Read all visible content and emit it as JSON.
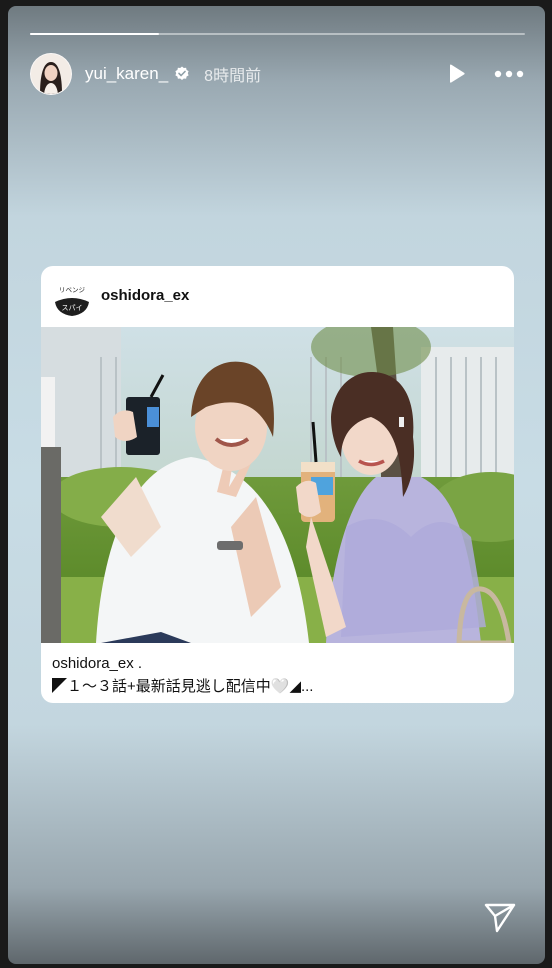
{
  "story": {
    "progress": 0.26,
    "username": "yui_karen_",
    "time_ago": "8時間前"
  },
  "shared_post": {
    "account": "oshidora_ex",
    "caption_user": "oshidora_ex .",
    "caption_text": "◤１～３話+最新話見逃し配信中🤍◢...",
    "logo_text": "リベンジスパイ"
  },
  "colors": {
    "accent": "#ffffff",
    "background": "#c8dce5"
  },
  "icons": [
    "verified-icon",
    "play-icon",
    "more-options-icon",
    "send-icon"
  ]
}
